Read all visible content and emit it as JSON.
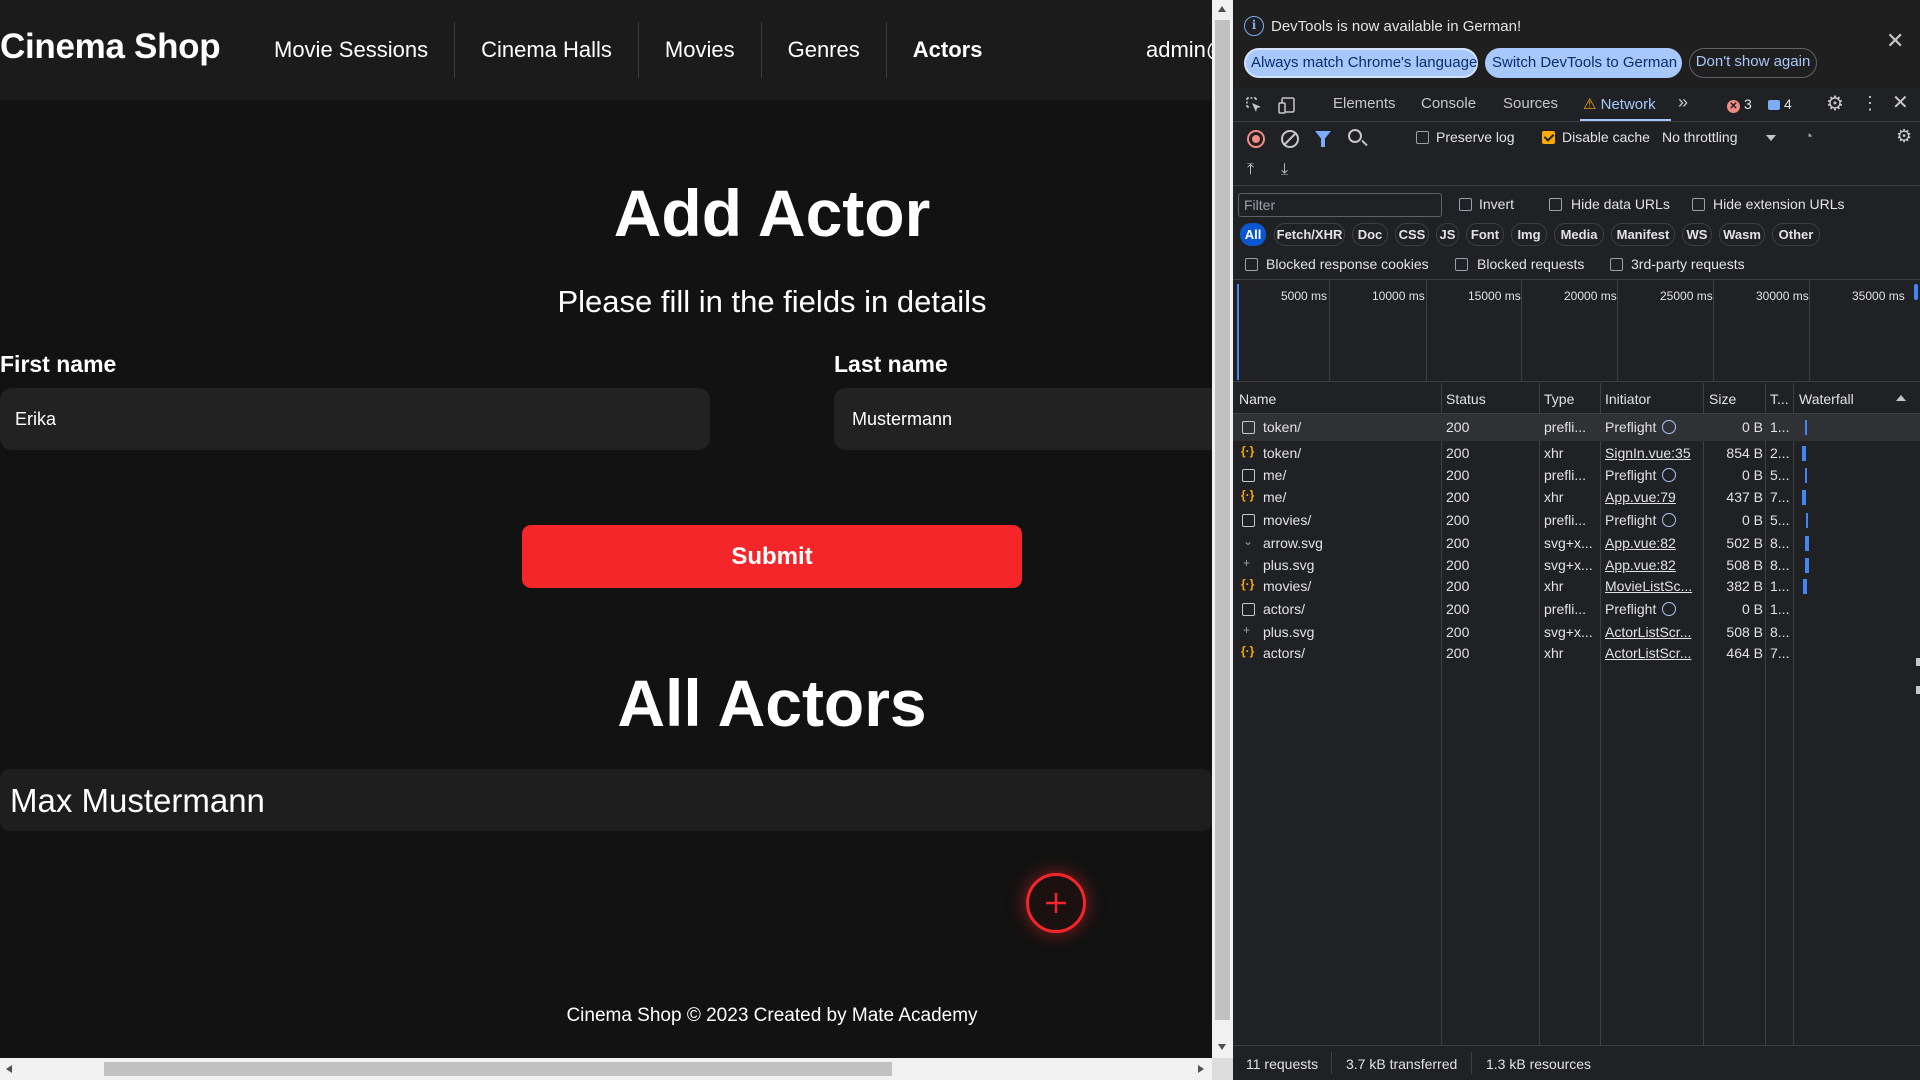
{
  "site": {
    "brand": "Cinema Shop",
    "nav": [
      "Movie Sessions",
      "Cinema Halls",
      "Movies",
      "Genres",
      "Actors"
    ],
    "active_nav": "Actors",
    "user": "admin@"
  },
  "form": {
    "title": "Add Actor",
    "subtitle": "Please fill in the fields in details",
    "first_label": "First name",
    "first_value": "Erika",
    "last_label": "Last name",
    "last_value": "Mustermann",
    "submit": "Submit"
  },
  "actors": {
    "title": "All Actors",
    "items": [
      "Max Mustermann"
    ]
  },
  "footer": "Cinema Shop © 2023 Created by Mate Academy",
  "devtools": {
    "notice": {
      "text": "DevTools is now available in German!",
      "always_btn": "Always match Chrome's language",
      "switch_btn": "Switch DevTools to German",
      "dont_btn": "Don't show again"
    },
    "tabs": [
      "Elements",
      "Console",
      "Sources",
      "Network"
    ],
    "active_tab": "Network",
    "errors": "3",
    "messages": "4",
    "toolbar": {
      "preserve_log": "Preserve log",
      "disable_cache": "Disable cache",
      "disable_cache_checked": true,
      "preserve_log_checked": false,
      "throttling": "No throttling"
    },
    "filter": {
      "placeholder": "Filter",
      "invert": "Invert",
      "hide_data_urls": "Hide data URLs",
      "hide_extension_urls": "Hide extension URLs",
      "types": [
        "All",
        "Fetch/XHR",
        "Doc",
        "CSS",
        "JS",
        "Font",
        "Img",
        "Media",
        "Manifest",
        "WS",
        "Wasm",
        "Other"
      ],
      "active_type": "All",
      "blocked_cookies": "Blocked response cookies",
      "blocked_requests": "Blocked requests",
      "third_party": "3rd-party requests"
    },
    "timeline_labels": [
      "5000 ms",
      "10000 ms",
      "15000 ms",
      "20000 ms",
      "25000 ms",
      "30000 ms",
      "35000 ms"
    ],
    "columns": [
      "Name",
      "Status",
      "Type",
      "Initiator",
      "Size",
      "T...",
      "Waterfall"
    ],
    "rows": [
      {
        "icon": "doc",
        "name": "token/",
        "status": "200",
        "type": "prefli...",
        "initiator": "Preflight",
        "init_link": false,
        "size": "0 B",
        "time": "1..."
      },
      {
        "icon": "xhr",
        "name": "token/",
        "status": "200",
        "type": "xhr",
        "initiator": "SignIn.vue:35",
        "init_link": true,
        "size": "854 B",
        "time": "2..."
      },
      {
        "icon": "doc",
        "name": "me/",
        "status": "200",
        "type": "prefli...",
        "initiator": "Preflight",
        "init_link": false,
        "size": "0 B",
        "time": "5..."
      },
      {
        "icon": "xhr",
        "name": "me/",
        "status": "200",
        "type": "xhr",
        "initiator": "App.vue:79",
        "init_link": true,
        "size": "437 B",
        "time": "7..."
      },
      {
        "icon": "doc",
        "name": "movies/",
        "status": "200",
        "type": "prefli...",
        "initiator": "Preflight",
        "init_link": false,
        "size": "0 B",
        "time": "5..."
      },
      {
        "icon": "img",
        "name": "arrow.svg",
        "status": "200",
        "type": "svg+x...",
        "initiator": "App.vue:82",
        "init_link": true,
        "size": "502 B",
        "time": "8..."
      },
      {
        "icon": "img",
        "name": "plus.svg",
        "status": "200",
        "type": "svg+x...",
        "initiator": "App.vue:82",
        "init_link": true,
        "size": "508 B",
        "time": "8..."
      },
      {
        "icon": "xhr",
        "name": "movies/",
        "status": "200",
        "type": "xhr",
        "initiator": "MovieListSc...",
        "init_link": true,
        "size": "382 B",
        "time": "1..."
      },
      {
        "icon": "doc",
        "name": "actors/",
        "status": "200",
        "type": "prefli...",
        "initiator": "Preflight",
        "init_link": false,
        "size": "0 B",
        "time": "1..."
      },
      {
        "icon": "img",
        "name": "plus.svg",
        "status": "200",
        "type": "svg+x...",
        "initiator": "ActorListScr...",
        "init_link": true,
        "size": "508 B",
        "time": "8..."
      },
      {
        "icon": "xhr",
        "name": "actors/",
        "status": "200",
        "type": "xhr",
        "initiator": "ActorListScr...",
        "init_link": true,
        "size": "464 B",
        "time": "7..."
      }
    ],
    "status": {
      "requests": "11 requests",
      "transferred": "3.7 kB transferred",
      "resources": "1.3 kB resources"
    }
  }
}
